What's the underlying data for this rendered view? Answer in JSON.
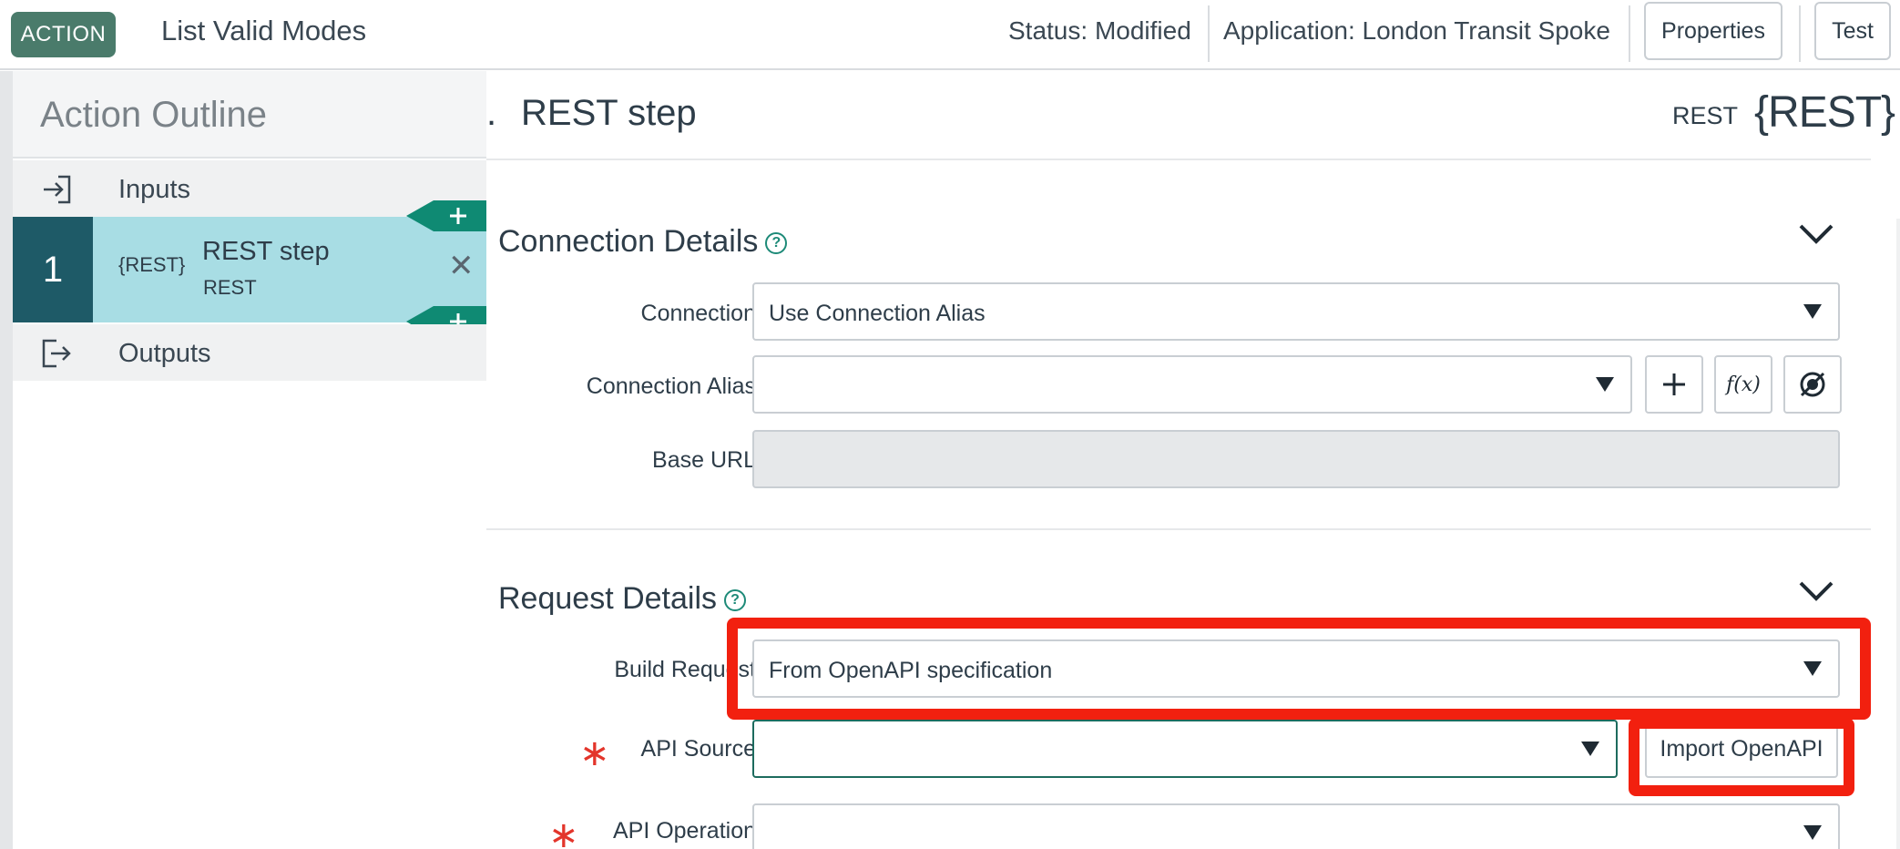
{
  "header": {
    "badge": "ACTION",
    "title": "List Valid Modes",
    "status": "Status: Modified",
    "application": "Application: London Transit Spoke",
    "properties_button": "Properties",
    "test_button": "Test"
  },
  "outline": {
    "title": "Action Outline",
    "inputs_label": "Inputs",
    "outputs_label": "Outputs",
    "step": {
      "number": "1",
      "icon_text": "{REST}",
      "name": "REST step",
      "type": "REST"
    }
  },
  "main": {
    "dot": ".",
    "title": "REST step",
    "type_label": "REST",
    "type_icon": "{REST}",
    "connection_section": {
      "title": "Connection Details",
      "help": "?",
      "connection_label": "Connection",
      "connection_value": "Use Connection Alias",
      "alias_label": "Connection Alias",
      "alias_value": "",
      "base_url_label": "Base URL",
      "base_url_value": ""
    },
    "request_section": {
      "title": "Request Details",
      "help": "?",
      "build_request_label": "Build Request",
      "build_request_value": "From OpenAPI specification",
      "api_source_label": "API Source",
      "api_source_value": "",
      "import_button": "Import OpenAPI",
      "api_operation_label": "API Operation",
      "api_operation_value": ""
    }
  },
  "icons": {
    "input": "input-arrow-icon",
    "output": "output-arrow-icon",
    "close": "close-icon",
    "add": "plus-icon",
    "function": "fx-icon",
    "datapill": "datapill-picker-icon",
    "chevron": "chevron-down-icon",
    "dropdown": "dropdown-arrow-icon",
    "required": "required-asterisk-icon"
  },
  "colors": {
    "accent": "#1d8a78",
    "badge": "#4a7b6b",
    "step_selected": "#a8dde4",
    "step_number_bg": "#1e5a67",
    "highlight": "#f2200f",
    "required": "#e3352b"
  }
}
